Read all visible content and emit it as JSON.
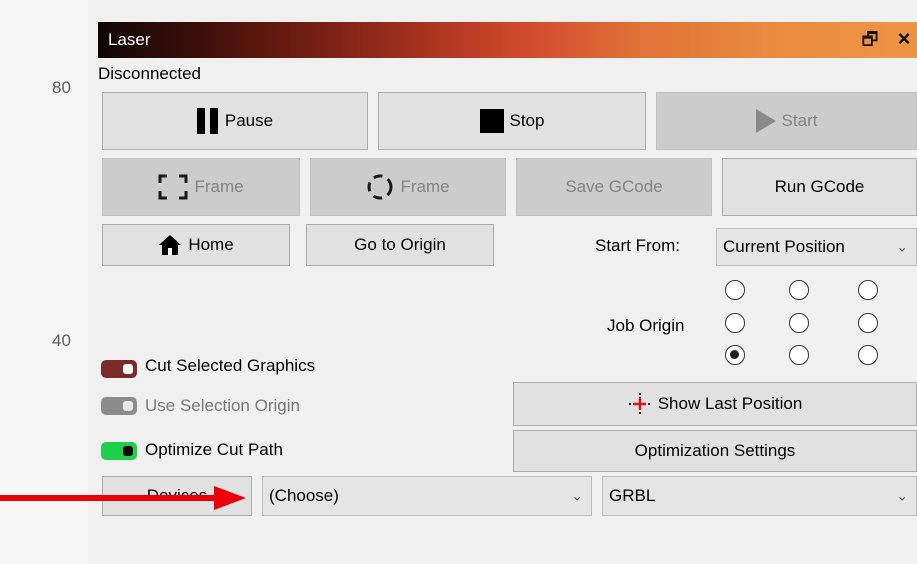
{
  "ruler": {
    "labels": [
      "80",
      "40"
    ]
  },
  "window": {
    "title": "Laser",
    "restore_glyph": "🗗",
    "close_glyph": "×"
  },
  "status": "Disconnected",
  "controls": {
    "pause": "Pause",
    "stop": "Stop",
    "start": "Start",
    "frame_rect": "Frame",
    "frame_circle": "Frame",
    "save_gcode": "Save GCode",
    "run_gcode": "Run GCode",
    "home": "Home",
    "go_origin": "Go to Origin"
  },
  "start_from": {
    "label": "Start From:",
    "value": "Current Position"
  },
  "job_origin": {
    "label": "Job Origin",
    "selected_row": 2,
    "selected_col": 0
  },
  "options": {
    "cut_selected": {
      "label": "Cut Selected Graphics",
      "state": "on",
      "color": "#7b2a2a"
    },
    "use_selection_origin": {
      "label": "Use Selection Origin",
      "state": "off",
      "color": "#8c8c8c"
    },
    "optimize_cut": {
      "label": "Optimize Cut Path",
      "state": "on",
      "color": "#1fd14a"
    }
  },
  "buttons": {
    "show_last_position": "Show Last Position",
    "optimization_settings": "Optimization Settings"
  },
  "devices": {
    "button": "Devices",
    "device_select": "(Choose)",
    "controller_select": "GRBL"
  },
  "annotation": {
    "arrow_color": "#e8000b"
  }
}
